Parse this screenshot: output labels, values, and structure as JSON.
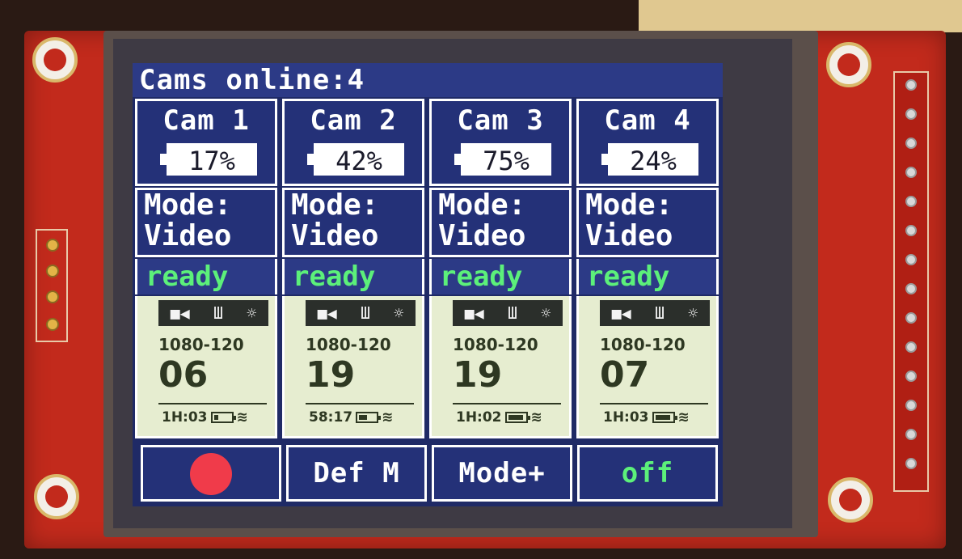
{
  "header": {
    "cams_online_label": "Cams online:",
    "cams_online_count": "4"
  },
  "cameras": [
    {
      "name": "Cam 1",
      "battery": "17%",
      "mode_label": "Mode:",
      "mode": "Video",
      "status": "ready",
      "resolution": "1080-120",
      "count": "06",
      "time": "1H:03",
      "battery_fill": 0.25
    },
    {
      "name": "Cam 2",
      "battery": "42%",
      "mode_label": "Mode:",
      "mode": "Video",
      "status": "ready",
      "resolution": "1080-120",
      "count": "19",
      "time": "58:17",
      "battery_fill": 0.5
    },
    {
      "name": "Cam 3",
      "battery": "75%",
      "mode_label": "Mode:",
      "mode": "Video",
      "status": "ready",
      "resolution": "1080-120",
      "count": "19",
      "time": "1H:02",
      "battery_fill": 0.9
    },
    {
      "name": "Cam 4",
      "battery": "24%",
      "mode_label": "Mode:",
      "mode": "Video",
      "status": "ready",
      "resolution": "1080-120",
      "count": "07",
      "time": "1H:03",
      "battery_fill": 0.9
    }
  ],
  "buttons": {
    "record_icon": "record-icon",
    "def_mode": "Def M",
    "mode_plus": "Mode+",
    "power": "off"
  },
  "icons": {
    "camera": "video-camera-icon",
    "protune": "protune-icon",
    "white_balance": "sun-icon",
    "wifi": "wifi-icon"
  },
  "colors": {
    "screen_bg": "#1f2a66",
    "status_green": "#5cf07a",
    "record_red": "#f03b4a",
    "gopro_panel": "#e6edd0"
  }
}
